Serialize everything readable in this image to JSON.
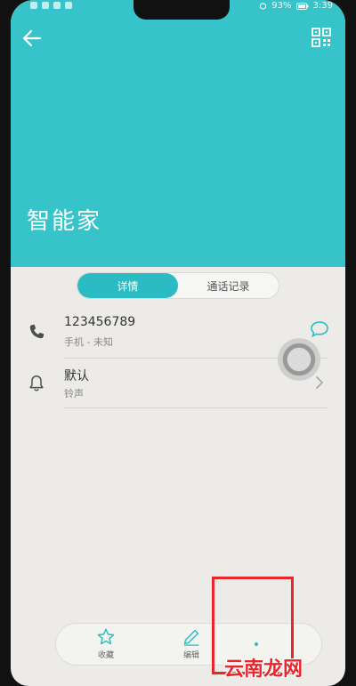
{
  "status_bar": {
    "battery": "93%",
    "time": "3:39"
  },
  "header": {
    "contact_name": "智能家",
    "background_color": "#36c3c9"
  },
  "tabs": [
    {
      "label": "详情",
      "active": true
    },
    {
      "label": "通话记录",
      "active": false
    }
  ],
  "details": {
    "phone": {
      "number": "123456789",
      "type": "手机 - 未知"
    },
    "ringtone": {
      "value": "默认",
      "label": "铃声"
    }
  },
  "bottom_actions": [
    {
      "label": "收藏",
      "icon": "star-icon"
    },
    {
      "label": "编辑",
      "icon": "pencil-icon"
    }
  ],
  "watermark": "云南龙网",
  "colors": {
    "accent": "#2bbcc3",
    "highlight": "#e8262b"
  }
}
